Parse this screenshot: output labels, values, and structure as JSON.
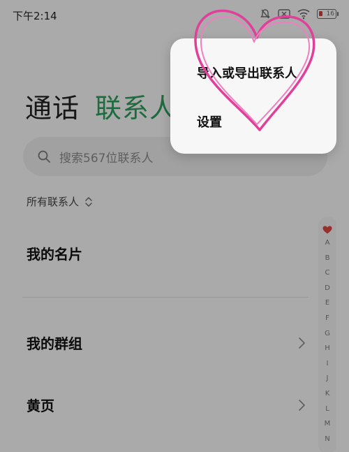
{
  "status_bar": {
    "time": "下午2:14",
    "icons": [
      "bell-icon",
      "close-box-icon",
      "wifi-icon",
      "battery-icon"
    ],
    "battery_level": "16"
  },
  "tabs": [
    {
      "label": "通话",
      "active": false
    },
    {
      "label": "联系人",
      "active": true,
      "color": "#2d9a5b"
    }
  ],
  "search": {
    "placeholder": "搜索567位联系人",
    "icon": "search-icon"
  },
  "filter": {
    "label": "所有联系人",
    "icon": "updown-icon"
  },
  "list": {
    "my_card": "我的名片",
    "my_groups": "我的群组",
    "yellow_pages": "黄页"
  },
  "alpha_index": {
    "favorite_icon": "heart-icon",
    "letters": [
      "A",
      "B",
      "C",
      "D",
      "E",
      "F",
      "G",
      "H",
      "I",
      "J",
      "K",
      "L",
      "M",
      "N"
    ]
  },
  "popup_menu": {
    "import_export": "导入或导出联系人",
    "settings": "设置"
  },
  "decoration": {
    "heart_color": "#e0409a"
  }
}
